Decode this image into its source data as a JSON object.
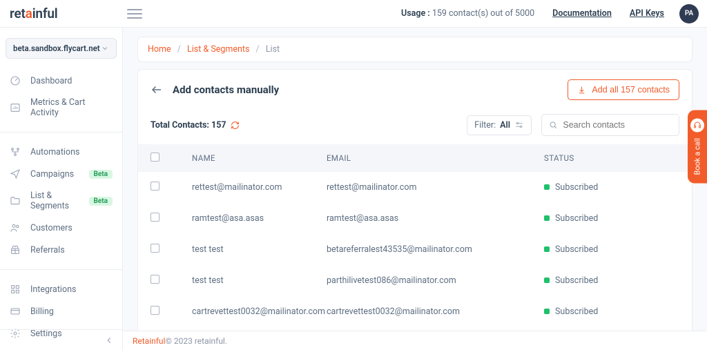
{
  "brand": {
    "name": "retainful",
    "accent_letter": "a"
  },
  "topbar": {
    "usage_label": "Usage :",
    "usage_value": " 159 contact(s) out of 5000",
    "doc_link": "Documentation",
    "api_link": "API Keys",
    "avatar_initials": "PA"
  },
  "sidebar": {
    "site": "beta.sandbox.flycart.net",
    "items": [
      {
        "label": "Dashboard"
      },
      {
        "label": "Metrics & Cart Activity"
      }
    ],
    "items2": [
      {
        "label": "Automations"
      },
      {
        "label": "Campaigns",
        "badge": "Beta"
      },
      {
        "label": "List & Segments",
        "badge": "Beta"
      },
      {
        "label": "Customers"
      },
      {
        "label": "Referrals"
      }
    ],
    "items3": [
      {
        "label": "Integrations"
      },
      {
        "label": "Billing"
      },
      {
        "label": "Settings"
      }
    ]
  },
  "breadcrumb": {
    "home": "Home",
    "section": "List & Segments",
    "current": "List"
  },
  "page": {
    "title": "Add contacts manually",
    "add_all_label": "Add all 157 contacts",
    "total_label": "Total Contacts:",
    "total_count": "157",
    "filter_label": "Filter:",
    "filter_value": "All",
    "search_placeholder": "Search contacts"
  },
  "columns": {
    "name": "NAME",
    "email": "EMAIL",
    "status": "STATUS"
  },
  "rows": [
    {
      "name": "rettest@mailinator.com",
      "email": "rettest@mailinator.com",
      "status": "Subscribed"
    },
    {
      "name": "ramtest@asa.asas",
      "email": "ramtest@asa.asas",
      "status": "Subscribed"
    },
    {
      "name": "test test",
      "email": "betareferralest43535@mailinator.com",
      "status": "Subscribed"
    },
    {
      "name": "test test",
      "email": "parthilivetest086@mailinator.com",
      "status": "Subscribed"
    },
    {
      "name": "cartrevettest0032@mailinator.com",
      "email": "cartrevettest0032@mailinator.com",
      "status": "Subscribed"
    }
  ],
  "footer": {
    "brand": "Retainful",
    "rest": " © 2023 retainful."
  },
  "book_call": "Book a call"
}
